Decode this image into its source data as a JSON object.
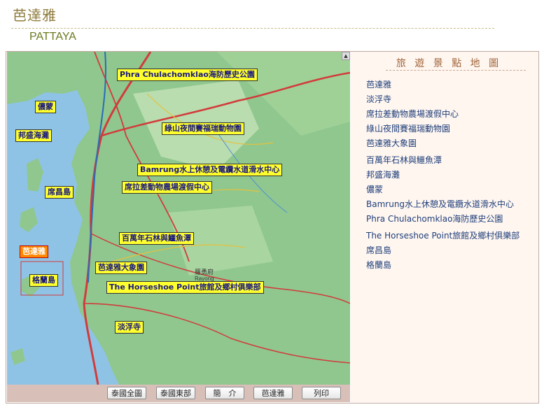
{
  "page": {
    "title": "芭達雅",
    "subtitle": "PATTAYA"
  },
  "map": {
    "labels": [
      {
        "id": "phra",
        "text": "Phra Chulachomklao海防歷史公園",
        "active": false
      },
      {
        "id": "nongnooch",
        "text": "儂蒙",
        "active": false
      },
      {
        "id": "bangsaen",
        "text": "邦盛海灘",
        "active": false
      },
      {
        "id": "khaokheow",
        "text": "綠山夜間賽福瑞動物園",
        "active": false
      },
      {
        "id": "bamrung",
        "text": "Bamrung水上休憩及電纜水道滑水中心",
        "active": false
      },
      {
        "id": "sichang",
        "text": "席昌島",
        "active": false
      },
      {
        "id": "sriracha",
        "text": "席拉差動物農場渡假中心",
        "active": false
      },
      {
        "id": "millionyear",
        "text": "百萬年石林與鱷魚潭",
        "active": false
      },
      {
        "id": "pattaya",
        "text": "芭達雅",
        "active": true
      },
      {
        "id": "elephant",
        "text": "芭達雅大象園",
        "active": false
      },
      {
        "id": "larn",
        "text": "格蘭島",
        "active": false
      },
      {
        "id": "horseshoe",
        "text": "The Horseshoe Point旅館及鄉村俱樂部",
        "active": false
      },
      {
        "id": "temple",
        "text": "淡浮寺",
        "active": false
      }
    ],
    "town_text": {
      "rayong_cn": "羅勇府",
      "rayong_en": "Rayong"
    },
    "colors": {
      "sea": "#8ec3e6",
      "land": "#8fc78f",
      "road": "#d23b3b",
      "label_bg": "#ffff2e",
      "active_label_bg": "#ff8800"
    }
  },
  "toolbar": {
    "buttons": [
      "泰國全圖",
      "泰國東部",
      "簡　介",
      "芭達雅",
      "列印"
    ]
  },
  "panel": {
    "heading": "旅 遊 景 點 地 圖",
    "items": [
      "芭達雅",
      "淡浮寺",
      "席拉差動物農場渡假中心",
      "綠山夜間賽福瑞動物園",
      "芭達雅大象園",
      "百萬年石林與鱷魚潭",
      "邦盛海灘",
      "儂蒙",
      "Bamrung水上休憩及電纜水道滑水中心",
      "Phra Chulachomklao海防歷史公園",
      "The Horseshoe Point旅館及鄉村俱樂部",
      "席昌島",
      "格蘭島"
    ]
  }
}
